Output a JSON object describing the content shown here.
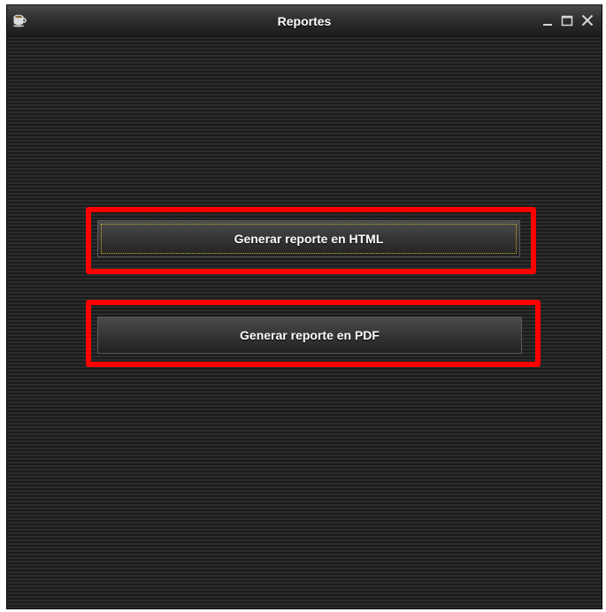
{
  "window": {
    "title": "Reportes",
    "icons": {
      "app": "coffee-cup-icon",
      "minimize": "minimize-icon",
      "maximize": "maximize-icon",
      "close": "close-icon"
    }
  },
  "buttons": {
    "html_label": "Generar reporte en HTML",
    "pdf_label": "Generar reporte en PDF"
  },
  "colors": {
    "highlight": "#ff0000",
    "background": "#242424",
    "text": "#ffffff",
    "focus_ring": "#c9b22a"
  }
}
